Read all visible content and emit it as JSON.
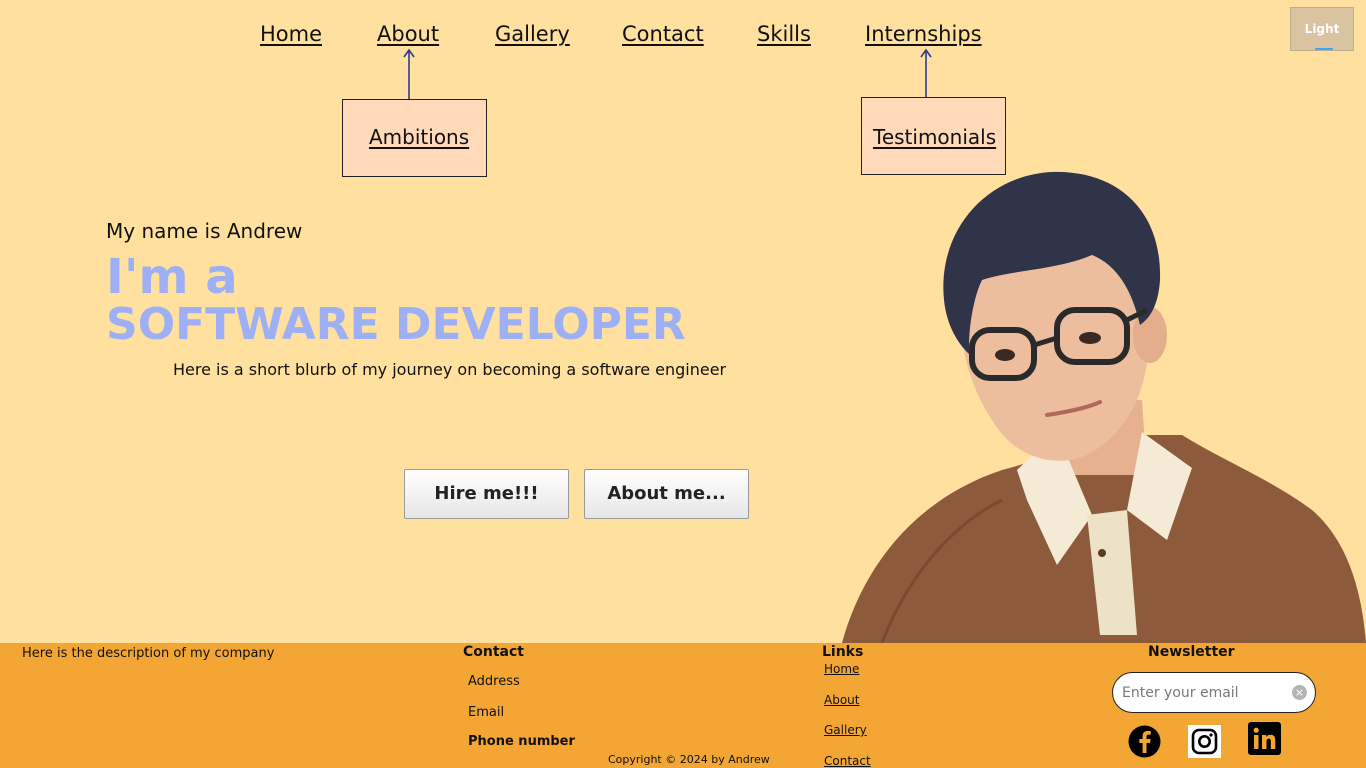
{
  "nav": {
    "items": [
      {
        "id": "home",
        "label": "Home"
      },
      {
        "id": "about",
        "label": "About"
      },
      {
        "id": "gallery",
        "label": "Gallery"
      },
      {
        "id": "contact",
        "label": "Contact"
      },
      {
        "id": "skills",
        "label": "Skills"
      },
      {
        "id": "internships",
        "label": "Internships"
      }
    ],
    "sub_about": "Ambitions",
    "sub_internships": "Testimonials"
  },
  "theme_toggle": {
    "label": "Light"
  },
  "hero": {
    "greeting": "My name is Andrew",
    "title_line1": "I'm a",
    "title_line2": "SOFTWARE DEVELOPER",
    "blurb": "Here is a short blurb of my journey on becoming a software engineer",
    "hire_button": "Hire me!!!",
    "about_button": "About me..."
  },
  "footer": {
    "description": "Here is the description of my company",
    "contact": {
      "heading": "Contact",
      "address": "Address",
      "email": "Email",
      "phone": "Phone number"
    },
    "links": {
      "heading": "Links",
      "items": [
        "Home",
        "About",
        "Gallery",
        "Contact"
      ]
    },
    "newsletter": {
      "heading": "Newsletter",
      "placeholder": "Enter your email"
    },
    "copyright": "Copyright © 2024 by Andrew",
    "socials": [
      "facebook-icon",
      "instagram-icon",
      "linkedin-icon"
    ]
  },
  "colors": {
    "page_bg": "#FFE09E",
    "footer_bg": "#F4A634",
    "hero_accent": "#9DB0F6",
    "submenu_bg": "#FFD9B8",
    "arrow": "#2E3A8C"
  }
}
